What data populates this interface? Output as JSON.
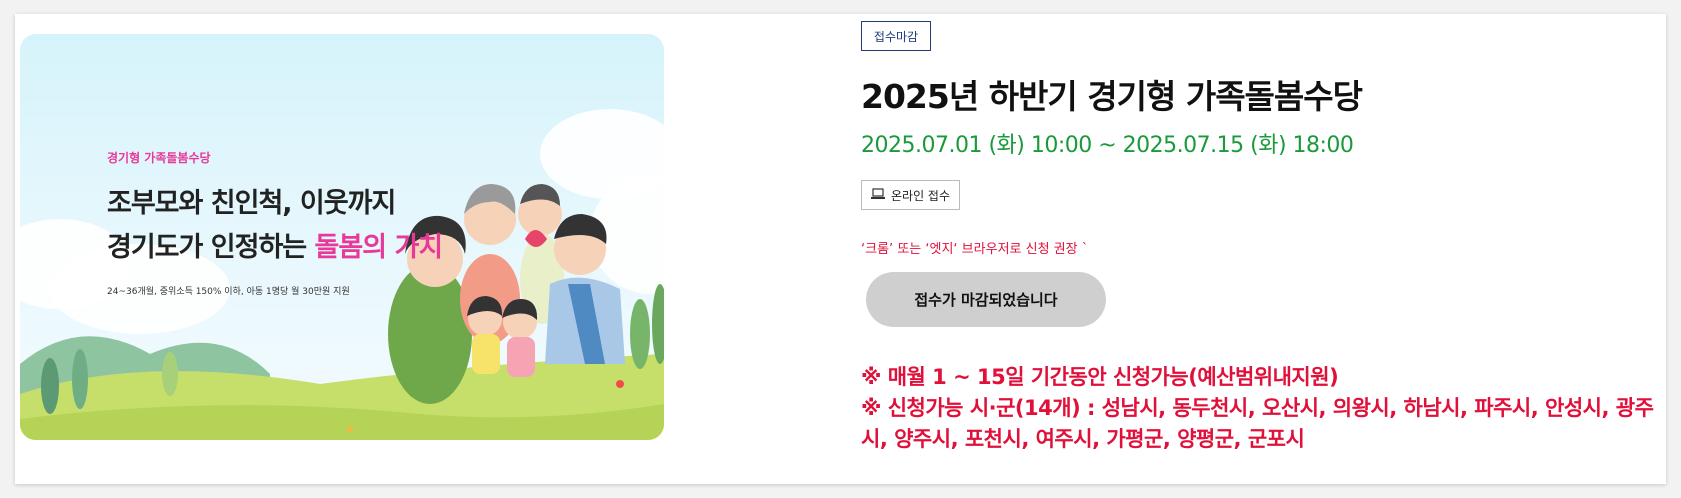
{
  "banner": {
    "subtitle": "경기형 가족돌봄수당",
    "title_line1": "조부모와 친인척, 이웃까지",
    "title_line2_prefix": "경기도가 인정하는 ",
    "title_line2_highlight": "돌봄의 가치",
    "note": "24~36개월, 중위소득 150% 이하, 아동 1명당 월 30만원 지원"
  },
  "status_badge": "접수마감",
  "title": "2025년 하반기 경기형 가족돌봄수당",
  "period": "2025.07.01 (화) 10:00 ~ 2025.07.15 (화) 18:00",
  "method": {
    "icon": "laptop-icon",
    "label": "온라인 접수"
  },
  "browser_note": "‘크롬’ 또는 ‘엣지‘ 브라우저로 신청 권장 `",
  "closed_button": "접수가 마감되었습니다",
  "notes": {
    "line1": "※ 매월 1 ~ 15일 기간동안 신청가능(예산범위내지원)",
    "line2": "※ 신청가능 시·군(14개) : 성남시, 동두천시, 오산시, 의왕시, 하남시, 파주시, 안성시, 광주시, 양주시, 포천시, 여주시, 가평군, 양평군, 군포시"
  },
  "colors": {
    "accent_pink": "#e8389a",
    "period_green": "#1a9a3a",
    "notice_red": "#e0103a",
    "badge_navy": "#1d3d7a"
  }
}
